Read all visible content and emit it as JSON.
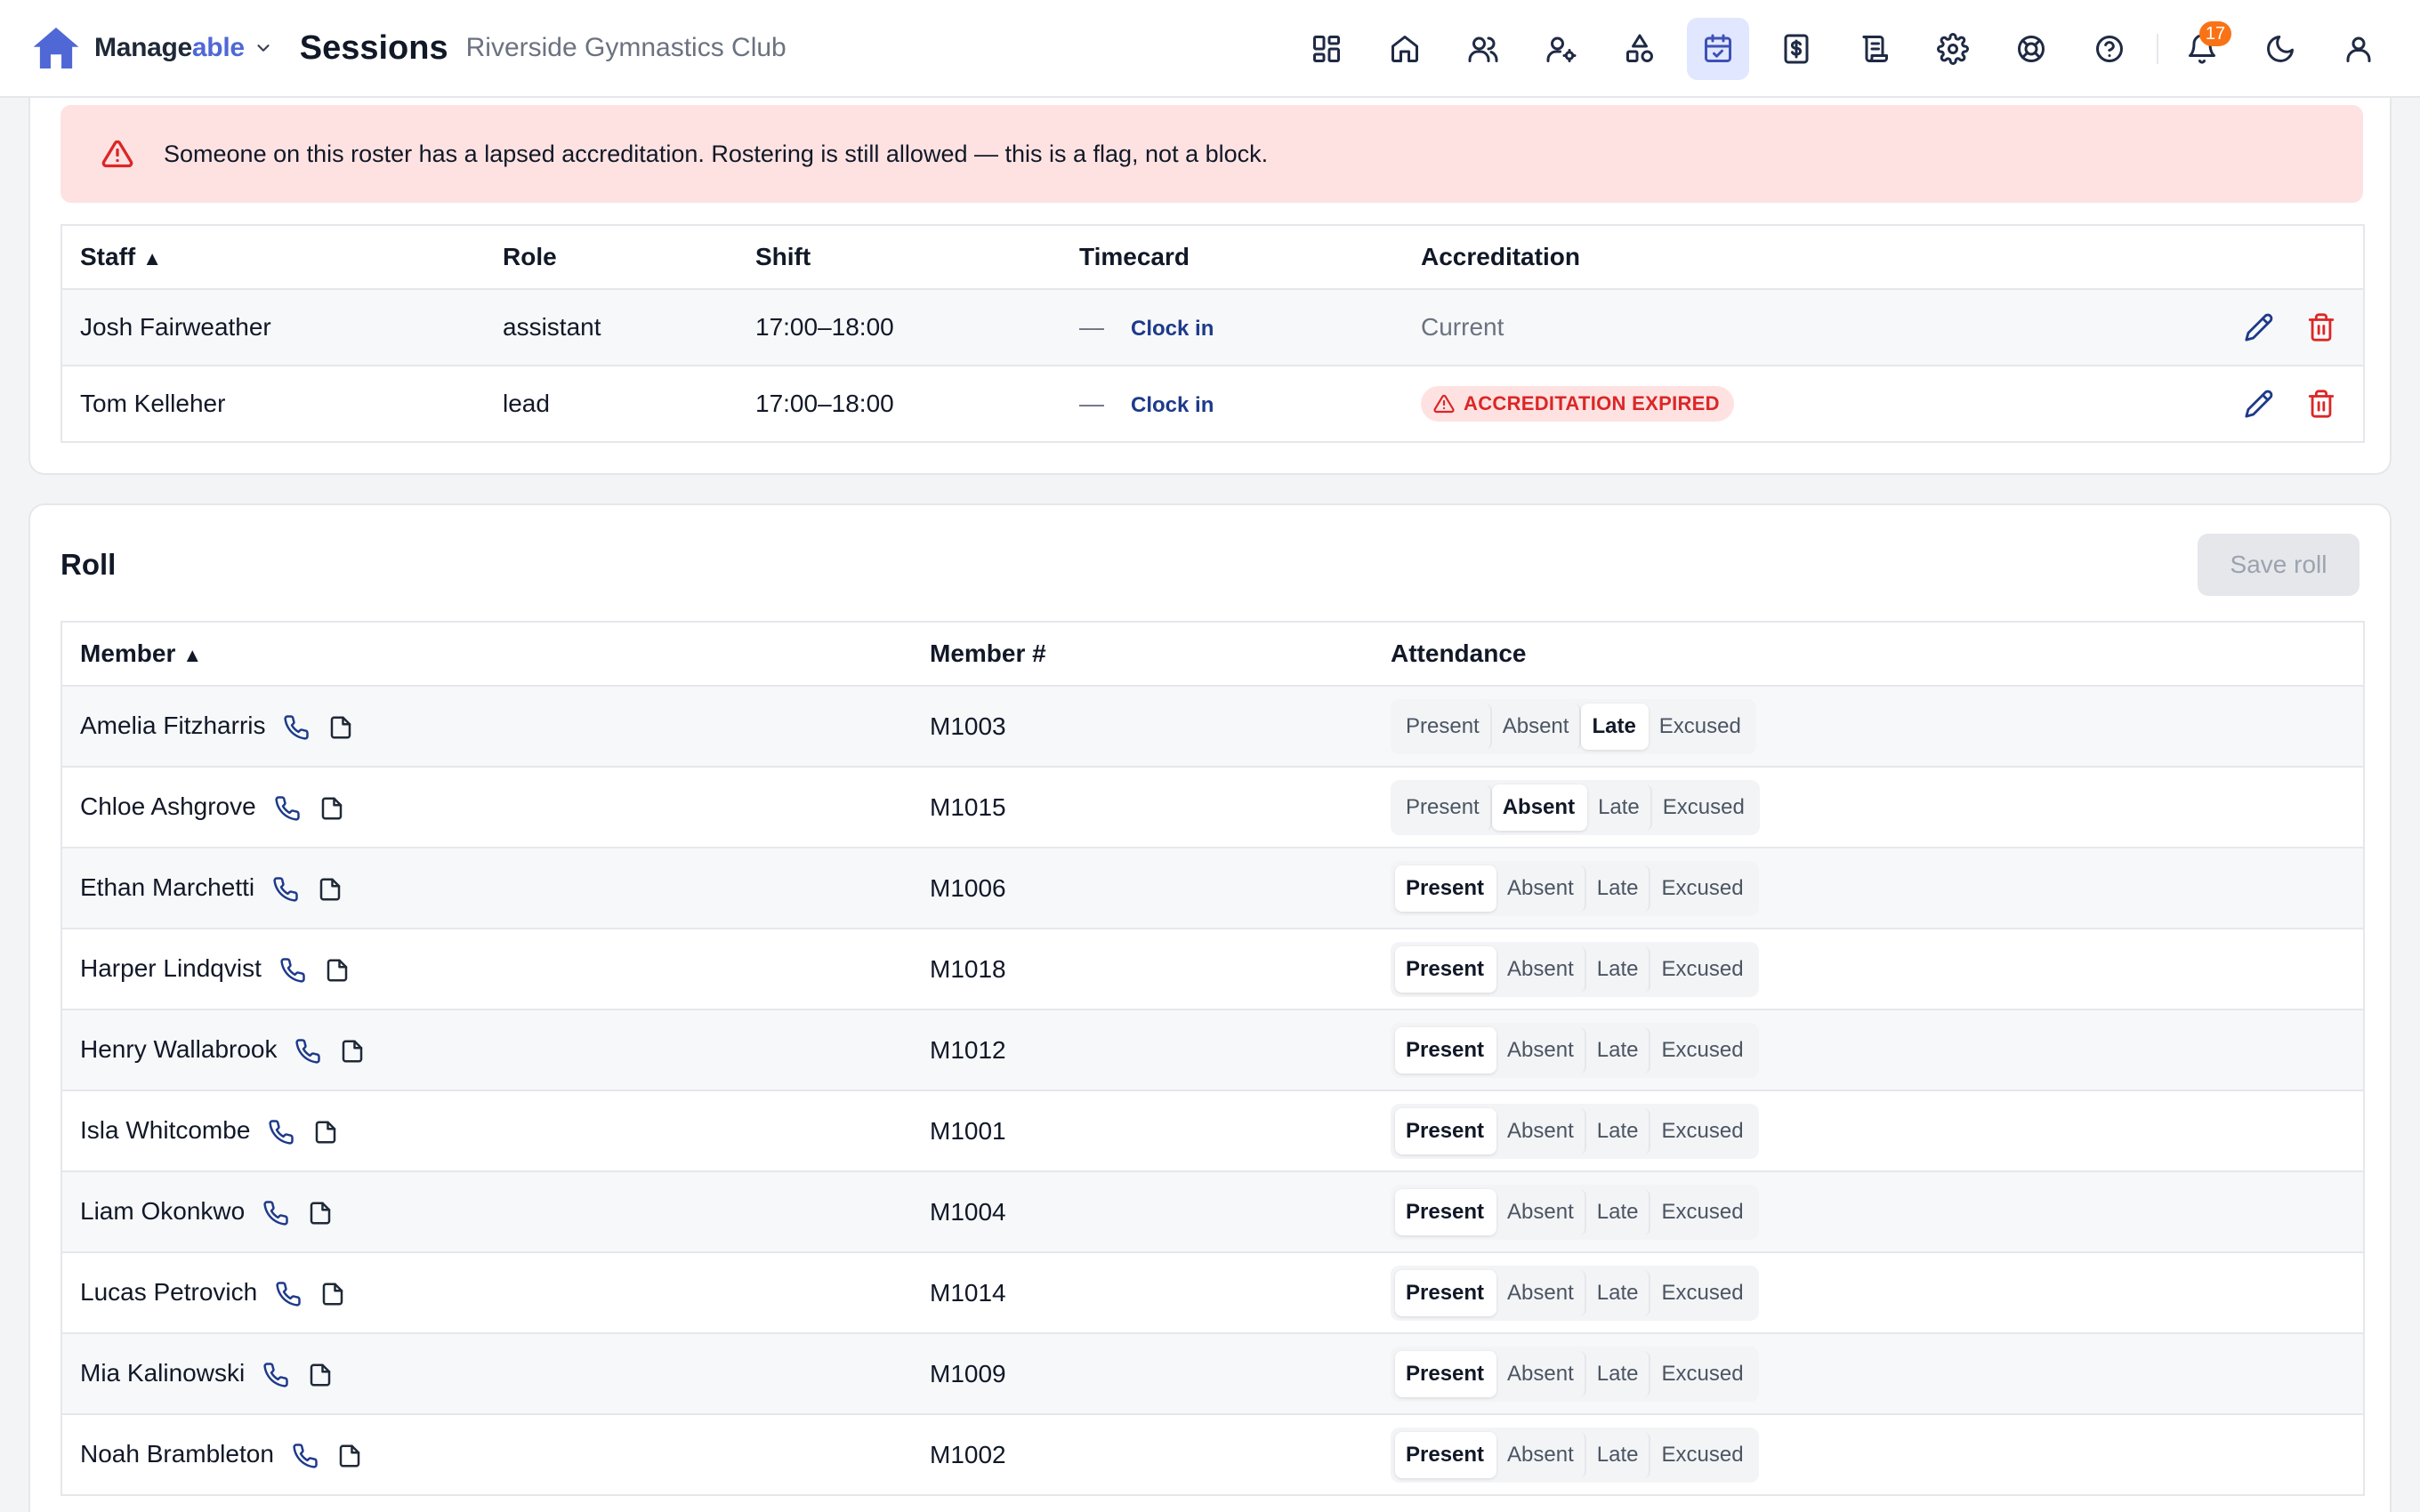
{
  "header": {
    "brand_prefix": "Manage",
    "brand_suffix": "able",
    "page_title": "Sessions",
    "org_name": "Riverside Gymnastics Club",
    "notification_count": "17",
    "accent_color": "#4f68d6",
    "nav_icons": [
      "dashboard-icon",
      "home-icon",
      "users-icon",
      "user-settings-icon",
      "shapes-icon",
      "calendar-check-icon",
      "dollar-file-icon",
      "scroll-icon",
      "gear-icon",
      "lifebuoy-icon",
      "help-icon",
      "bell-icon",
      "moon-icon",
      "user-icon"
    ]
  },
  "alert": {
    "text": "Someone on this roster has a lapsed accreditation. Rostering is still allowed — this is a flag, not a block."
  },
  "staff_table": {
    "headers": [
      "Staff",
      "Role",
      "Shift",
      "Timecard",
      "Accreditation"
    ],
    "sort_indicator": "▲",
    "rows": [
      {
        "name": "Josh Fairweather",
        "role": "assistant",
        "shift": "17:00–18:00",
        "timecard_dash": "—",
        "timecard_action": "Clock in",
        "accreditation": "Current"
      },
      {
        "name": "Tom Kelleher",
        "role": "lead",
        "shift": "17:00–18:00",
        "timecard_dash": "—",
        "timecard_action": "Clock in",
        "accreditation": "ACCREDITATION EXPIRED"
      }
    ]
  },
  "roll": {
    "title": "Roll",
    "save_label": "Save roll",
    "headers": [
      "Member",
      "Member #",
      "Attendance"
    ],
    "sort_indicator": "▲",
    "options": [
      "Present",
      "Absent",
      "Late",
      "Excused"
    ],
    "members": [
      {
        "name": "Amelia Fitzharris",
        "number": "M1003",
        "status": "Late"
      },
      {
        "name": "Chloe Ashgrove",
        "number": "M1015",
        "status": "Absent"
      },
      {
        "name": "Ethan Marchetti",
        "number": "M1006",
        "status": "Present"
      },
      {
        "name": "Harper Lindqvist",
        "number": "M1018",
        "status": "Present"
      },
      {
        "name": "Henry Wallabrook",
        "number": "M1012",
        "status": "Present"
      },
      {
        "name": "Isla Whitcombe",
        "number": "M1001",
        "status": "Present"
      },
      {
        "name": "Liam Okonkwo",
        "number": "M1004",
        "status": "Present"
      },
      {
        "name": "Lucas Petrovich",
        "number": "M1014",
        "status": "Present"
      },
      {
        "name": "Mia Kalinowski",
        "number": "M1009",
        "status": "Present"
      },
      {
        "name": "Noah Brambleton",
        "number": "M1002",
        "status": "Present"
      }
    ]
  }
}
